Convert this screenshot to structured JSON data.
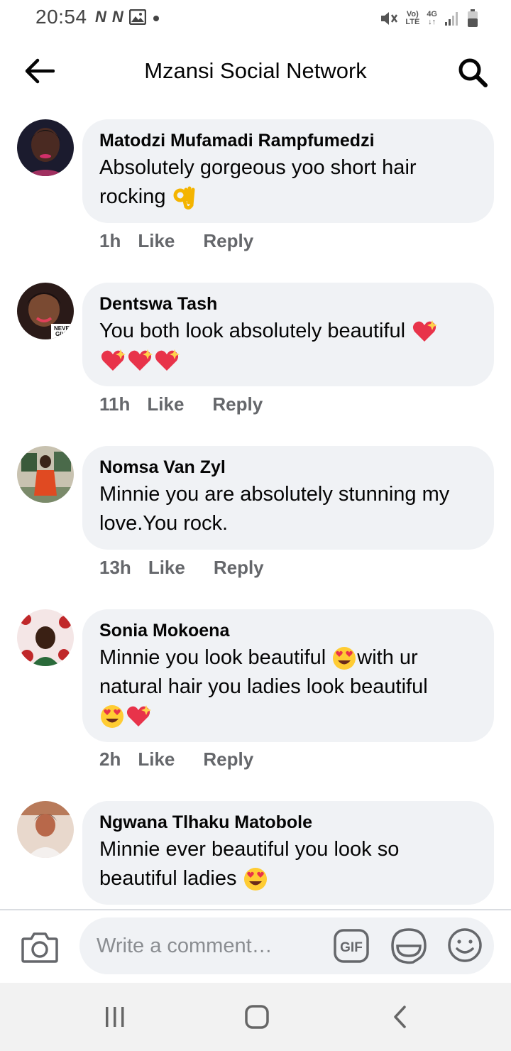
{
  "status_bar": {
    "time": "20:54",
    "left_icons": [
      "N",
      "N"
    ],
    "network_top": "Vo)",
    "network_bottom": "LTE",
    "signal_top": "4G",
    "signal_bottom": "↓↑"
  },
  "header": {
    "title": "Mzansi Social Network"
  },
  "comments": [
    {
      "author": "Matodzi Mufamadi Rampfumedzi",
      "text": "Absolutely gorgeous yoo short hair rocking",
      "emoji": [
        "ok-hand"
      ],
      "time": "1h",
      "like": "Like",
      "reply": "Reply",
      "avatar_color": "#5a2a4a"
    },
    {
      "author": "Dentswa Tash",
      "text": "You both look absolutely beautiful",
      "emoji": [
        "sparkling-heart",
        "sparkling-heart",
        "sparkling-heart",
        "sparkling-heart"
      ],
      "time": "11h",
      "like": "Like",
      "reply": "Reply",
      "avatar_color": "#7a3b2a"
    },
    {
      "author": "Nomsa Van Zyl",
      "text": "Minnie you are absolutely stunning my love.You rock.",
      "emoji": [],
      "time": "13h",
      "like": "Like",
      "reply": "Reply",
      "avatar_color": "#6b7a5a"
    },
    {
      "author": "Sonia Mokoena",
      "text_part1": "Minnie you look beautiful",
      "text_part2": "with ur natural hair you ladies look beautiful",
      "emoji": [
        "heart-eyes",
        "heart-eyes",
        "sparkling-heart"
      ],
      "time": "2h",
      "like": "Like",
      "reply": "Reply",
      "avatar_color": "#b0302a"
    },
    {
      "author": "Ngwana Tlhaku Matobole",
      "text": "Minnie ever beautiful  you look so beautiful ladies",
      "emoji": [
        "heart-eyes"
      ],
      "avatar_color": "#c98a7a"
    }
  ],
  "composer": {
    "placeholder": "Write a comment…",
    "gif_label": "GIF"
  },
  "colors": {
    "bubble": "#f0f2f5",
    "meta_text": "#65676b",
    "nav_bar": "#f2f2f2"
  }
}
